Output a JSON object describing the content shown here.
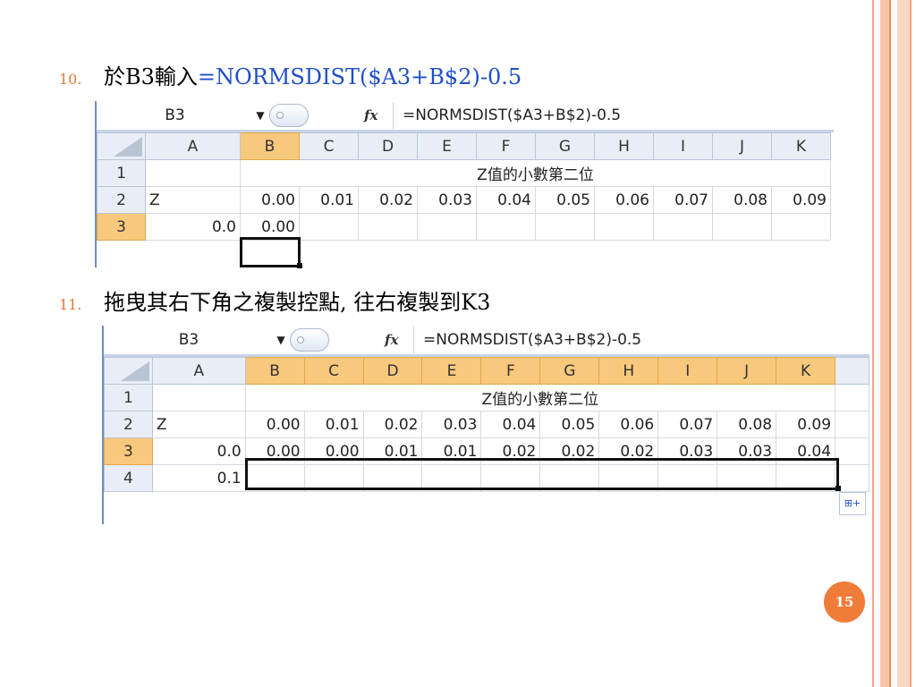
{
  "steps": [
    {
      "number": "10.",
      "prefix": "於B3輸入",
      "command": "=NORMSDIST($A3+B$2)-0.5"
    },
    {
      "number": "11.",
      "text": "拖曳其右下角之複製控點, 往右複製到K3"
    }
  ],
  "sheet1": {
    "name_box": "B3",
    "fx_label": "fx",
    "formula": "=NORMSDIST($A3+B$2)-0.5",
    "columns": [
      "A",
      "B",
      "C",
      "D",
      "E",
      "F",
      "G",
      "H",
      "I",
      "J",
      "K"
    ],
    "row_numbers": [
      "1",
      "2",
      "3"
    ],
    "row1_label": "Z值的小數第二位",
    "row2": [
      "Z",
      "0.00",
      "0.01",
      "0.02",
      "0.03",
      "0.04",
      "0.05",
      "0.06",
      "0.07",
      "0.08",
      "0.09"
    ],
    "row3": [
      "0.0",
      "0.00",
      "",
      "",
      "",
      "",
      "",
      "",
      "",
      "",
      ""
    ]
  },
  "sheet2": {
    "name_box": "B3",
    "fx_label": "fx",
    "formula": "=NORMSDIST($A3+B$2)-0.5",
    "columns": [
      "A",
      "B",
      "C",
      "D",
      "E",
      "F",
      "G",
      "H",
      "I",
      "J",
      "K"
    ],
    "row_numbers": [
      "1",
      "2",
      "3",
      "4"
    ],
    "row1_label": "Z值的小數第二位",
    "row2": [
      "Z",
      "0.00",
      "0.01",
      "0.02",
      "0.03",
      "0.04",
      "0.05",
      "0.06",
      "0.07",
      "0.08",
      "0.09"
    ],
    "row3": [
      "0.0",
      "0.00",
      "0.00",
      "0.01",
      "0.01",
      "0.02",
      "0.02",
      "0.02",
      "0.03",
      "0.03",
      "0.04"
    ],
    "row4": [
      "0.1",
      "",
      "",
      "",
      "",
      "",
      "",
      "",
      "",
      "",
      ""
    ]
  },
  "page_number": "15",
  "colors": {
    "accent": "#f07c3a",
    "formula_text": "#1f4ec9",
    "selected_header": "#f8c87c"
  }
}
